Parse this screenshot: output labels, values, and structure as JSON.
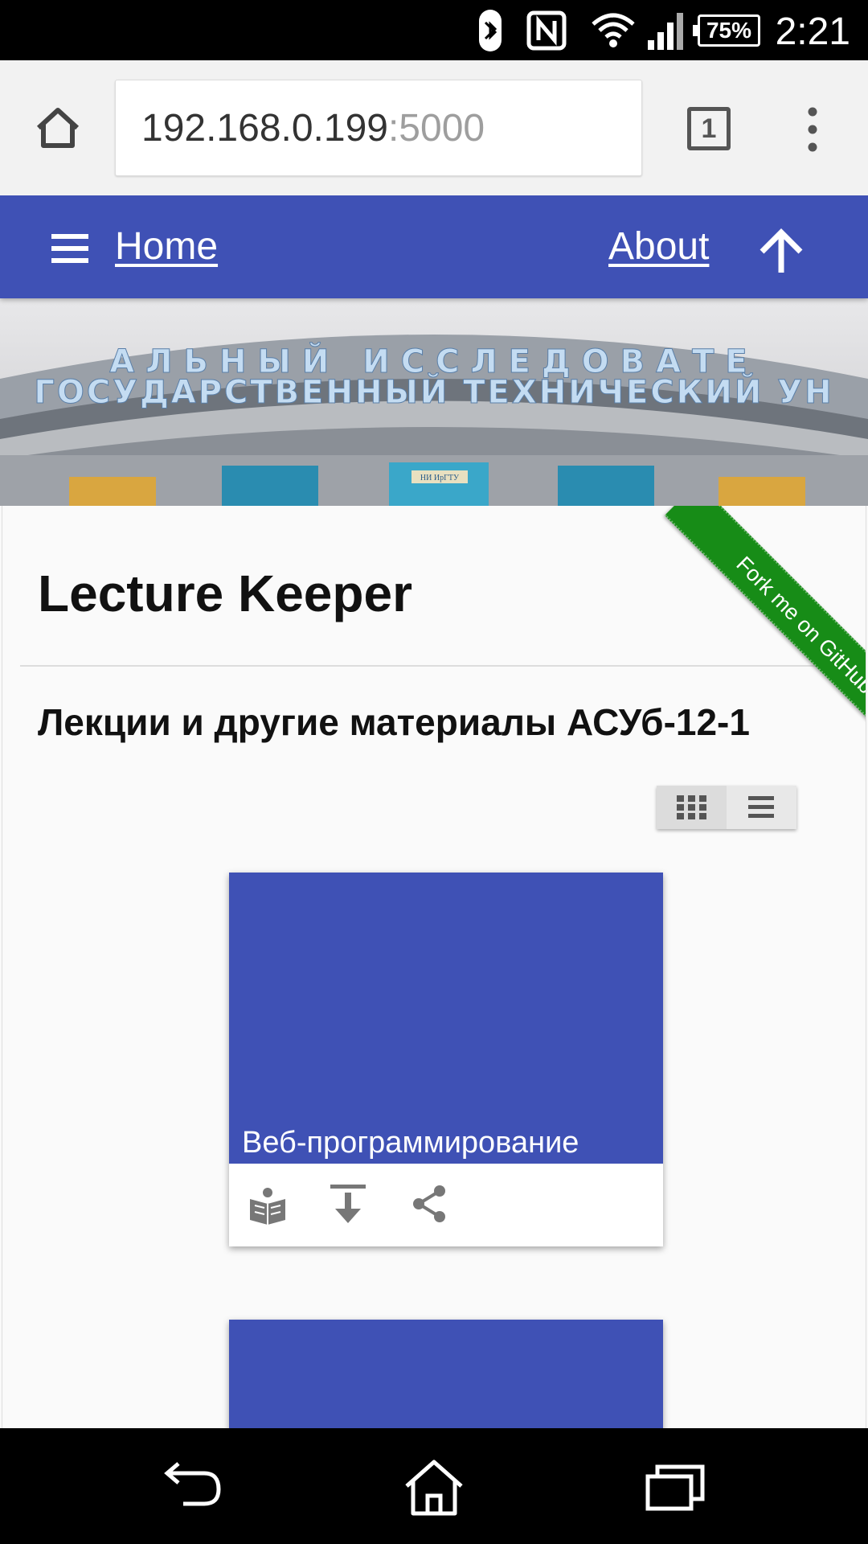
{
  "status_bar": {
    "time": "2:21",
    "battery": "75%",
    "icons": [
      "bluetooth-icon",
      "nfc-icon",
      "wifi-icon",
      "signal-icon",
      "battery-icon"
    ]
  },
  "browser": {
    "url_host": "192.168.0.199",
    "url_port": ":5000",
    "tab_count": "1"
  },
  "navbar": {
    "home_label": "Home",
    "about_label": "About",
    "color": "#3f51b5"
  },
  "banner": {
    "line1": "АЛЬНЫЙ ИССЛЕДОВАТЕ",
    "line2": "ГОСУДАРСТВЕННЫЙ ТЕХНИЧЕСКИЙ УН",
    "sign": "НИ ИрГТУ"
  },
  "content": {
    "title": "Lecture Keeper",
    "subtitle": "Лекции и другие материалы АСУб-12-1",
    "ribbon": "Fork me on GitHub"
  },
  "view_toggle": [
    "grid-view-icon",
    "list-view-icon"
  ],
  "cards": [
    {
      "title": "Веб-программирование",
      "actions": [
        "read-icon",
        "download-icon",
        "share-icon"
      ]
    },
    {
      "title": ""
    }
  ],
  "colors": {
    "accent": "#3f51b5",
    "ribbon": "#178c17"
  }
}
